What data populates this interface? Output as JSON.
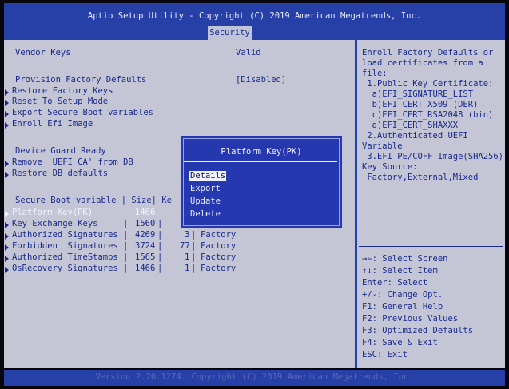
{
  "header": {
    "title": "Aptio Setup Utility - Copyright (C) 2019 American Megatrends, Inc.",
    "tab": "Security"
  },
  "main": {
    "vendor_keys": {
      "label": "Vendor Keys",
      "value": "Valid"
    },
    "provision": {
      "label": "Provision Factory Defaults",
      "value": "[Disabled]"
    },
    "menu_items": [
      "Restore Factory Keys",
      "Reset To Setup Mode",
      "Export Secure Boot variables",
      "Enroll Efi Image"
    ],
    "device_guard": {
      "label": "Device Guard Ready",
      "items": [
        "Remove 'UEFI CA' from DB",
        "Restore DB defaults"
      ]
    },
    "sb_table": {
      "header": "Secure Boot variable | Size| Ke",
      "rows": [
        {
          "name": "Platform Key(PK)",
          "size": "1466",
          "count": "",
          "source": "",
          "highlighted": true
        },
        {
          "name": "Key Exchange Keys",
          "size": "1560",
          "count": "",
          "source": "",
          "highlighted": false
        },
        {
          "name": "Authorized Signatures",
          "size": "4269",
          "count": "3",
          "source": "Factory",
          "highlighted": false
        },
        {
          "name": "Forbidden  Signatures",
          "size": "3724",
          "count": "77",
          "source": "Factory",
          "highlighted": false
        },
        {
          "name": "Authorized TimeStamps",
          "size": "1565",
          "count": "1",
          "source": "Factory",
          "highlighted": false
        },
        {
          "name": "OsRecovery Signatures",
          "size": "1466",
          "count": "1",
          "source": "Factory",
          "highlighted": false
        }
      ]
    }
  },
  "popup": {
    "title": "Platform Key(PK)",
    "options": [
      "Details",
      "Export",
      "Update",
      "Delete"
    ],
    "selected_index": 0
  },
  "help": {
    "description": [
      "Enroll Factory Defaults or",
      "load certificates from a",
      "file:",
      " 1.Public Key Certificate:",
      "  a)EFI_SIGNATURE_LIST",
      "  b)EFI_CERT_X509 (DER)",
      "  c)EFI_CERT_RSA2048 (bin)",
      "  d)EFI_CERT_SHAXXX",
      " 2.Authenticated UEFI",
      "Variable",
      " 3.EFI PE/COFF Image(SHA256)",
      "Key Source:",
      " Factory,External,Mixed"
    ],
    "keys": [
      "→←: Select Screen",
      "↑↓: Select Item",
      "Enter: Select",
      "+/-: Change Opt.",
      "F1: General Help",
      "F2: Previous Values",
      "F3: Optimized Defaults",
      "F4: Save & Exit",
      "ESC: Exit"
    ]
  },
  "footer": {
    "text": "Version 2.20.1274. Copyright (C) 2019 American Megatrends, Inc."
  },
  "colors": {
    "header_bg": "#2640a8",
    "panel_bg": "#c4c6d6",
    "text": "#1a2a8c",
    "highlight": "#f2f2ff",
    "popup_bg": "#2538b0"
  }
}
